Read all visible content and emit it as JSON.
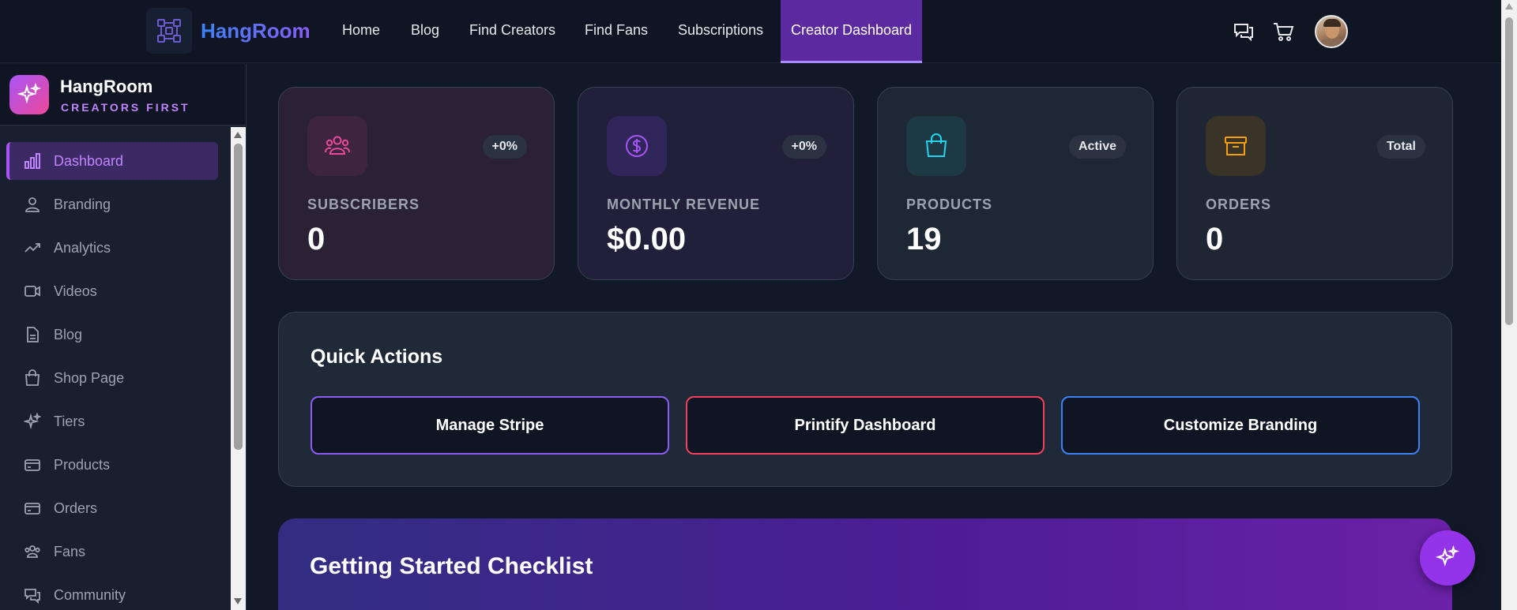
{
  "nav": {
    "brand": "HangRoom",
    "links": [
      "Home",
      "Blog",
      "Find Creators",
      "Find Fans",
      "Subscriptions"
    ],
    "active": "Creator Dashboard",
    "icons": [
      "chat-icon",
      "cart-icon",
      "avatar"
    ]
  },
  "sidebar": {
    "title": "HangRoom",
    "subtitle": "CREATORS FIRST",
    "items": [
      {
        "label": "Dashboard",
        "icon": "bar-chart-icon"
      },
      {
        "label": "Branding",
        "icon": "user-icon"
      },
      {
        "label": "Analytics",
        "icon": "trend-icon"
      },
      {
        "label": "Videos",
        "icon": "video-icon"
      },
      {
        "label": "Blog",
        "icon": "document-icon"
      },
      {
        "label": "Shop Page",
        "icon": "bag-icon"
      },
      {
        "label": "Tiers",
        "icon": "sparkles-icon"
      },
      {
        "label": "Products",
        "icon": "card-icon"
      },
      {
        "label": "Orders",
        "icon": "card-icon"
      },
      {
        "label": "Fans",
        "icon": "users-icon"
      },
      {
        "label": "Community",
        "icon": "chat-icon"
      }
    ]
  },
  "stats": [
    {
      "label": "SUBSCRIBERS",
      "value": "0",
      "badge": "+0%",
      "icon": "users-icon",
      "color": "#ec4899"
    },
    {
      "label": "MONTHLY REVENUE",
      "value": "$0.00",
      "badge": "+0%",
      "icon": "dollar-icon",
      "color": "#a855f7"
    },
    {
      "label": "PRODUCTS",
      "value": "19",
      "badge": "Active",
      "icon": "bag-icon",
      "color": "#22d3ee"
    },
    {
      "label": "ORDERS",
      "value": "0",
      "badge": "Total",
      "icon": "archive-icon",
      "color": "#f59e0b"
    }
  ],
  "quick_actions": {
    "title": "Quick Actions",
    "buttons": [
      {
        "label": "Manage Stripe",
        "color": "#8b5cf6"
      },
      {
        "label": "Printify Dashboard",
        "color": "#f43f5e"
      },
      {
        "label": "Customize Branding",
        "color": "#3b82f6"
      }
    ]
  },
  "checklist": {
    "title": "Getting Started Checklist"
  }
}
